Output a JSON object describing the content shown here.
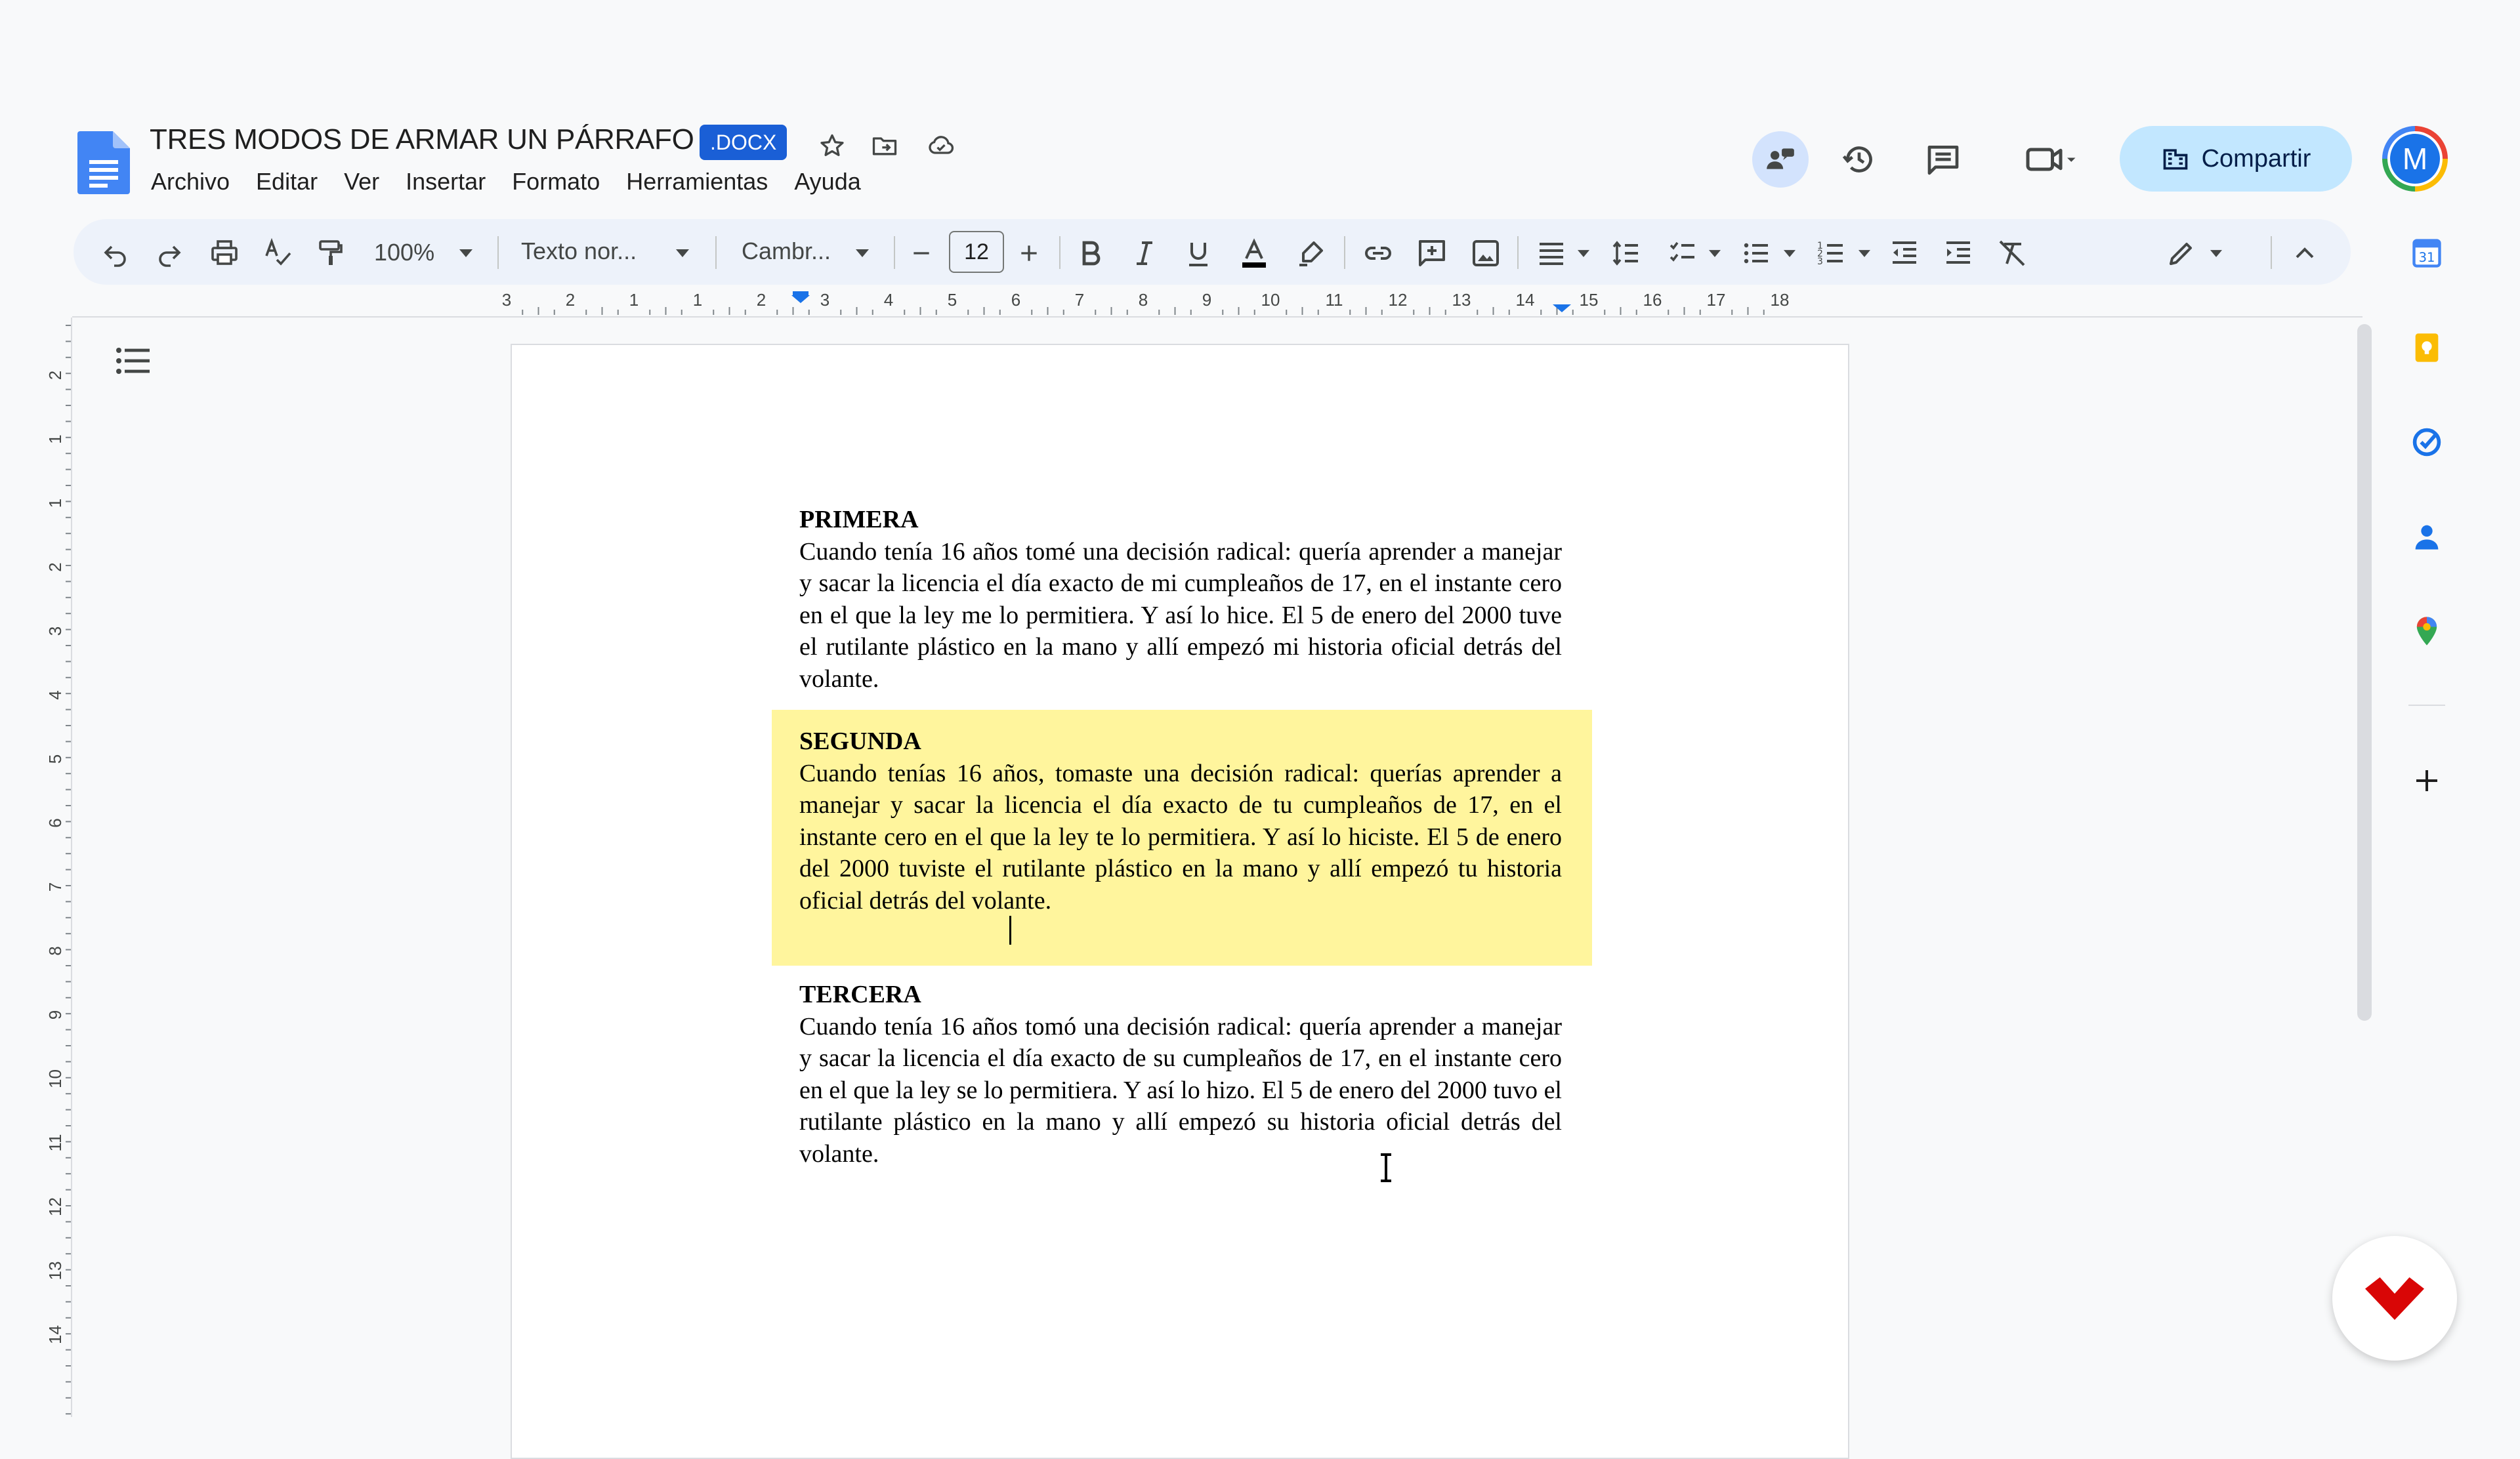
{
  "header": {
    "title": "TRES MODOS DE ARMAR UN PÁRRAFO",
    "badge": ".DOCX",
    "menu": [
      "Archivo",
      "Editar",
      "Ver",
      "Insertar",
      "Formato",
      "Herramientas",
      "Ayuda"
    ],
    "share_label": "Compartir",
    "avatar_letter": "M"
  },
  "toolbar": {
    "zoom": "100%",
    "style": "Texto nor...",
    "font": "Cambr...",
    "font_size": "12"
  },
  "ruler": {
    "labels": [
      "3",
      "2",
      "1",
      "1",
      "2",
      "3",
      "4",
      "5",
      "6",
      "7",
      "8",
      "9",
      "10",
      "11",
      "12",
      "13",
      "14",
      "15",
      "16",
      "17",
      "18"
    ],
    "vertical_labels": [
      "2",
      "1",
      "1",
      "2",
      "3",
      "4",
      "5",
      "6",
      "7",
      "8",
      "9",
      "10",
      "11",
      "12",
      "13",
      "14"
    ]
  },
  "document": {
    "paragraphs": [
      {
        "heading": "PRIMERA",
        "body": "Cuando tenía 16 años tomé una decisión radical: quería aprender a manejar y sacar la licencia el día exacto de mi cumpleaños de 17, en el instante cero en el que la ley me lo permitiera. Y así lo hice. El 5 de enero del 2000 tuve el rutilante plástico en la mano y allí empezó mi historia oficial detrás del volante."
      },
      {
        "heading": "SEGUNDA",
        "body": "Cuando tenías 16 años, tomaste una decisión radical: querías aprender a manejar y sacar la licencia el día exacto de tu cumpleaños de 17, en el instante cero en el que la ley te lo permitiera. Y así lo hiciste. El 5 de enero del 2000 tuviste el rutilante plástico en la mano y allí empezó tu historia oficial detrás del volante."
      },
      {
        "heading": "TERCERA",
        "body": "Cuando tenía 16 años tomó una decisión radical: quería aprender a manejar y sacar la licencia el día exacto de su cumpleaños de 17, en el instante cero en el que la ley se lo permitiera. Y así lo hizo. El 5 de enero del 2000 tuvo el rutilante plástico en la mano y allí empezó su historia oficial detrás del volante."
      }
    ]
  },
  "colors": {
    "highlight": "#fff59d",
    "share_bg": "#c2e7ff",
    "badge_bg": "#1a5fd6",
    "doc_icon": "#4285f4"
  },
  "side_panel": {
    "icons": [
      "calendar-icon",
      "keep-icon",
      "tasks-icon",
      "contacts-icon",
      "maps-icon",
      "add-icon"
    ],
    "calendar_day": "31"
  }
}
